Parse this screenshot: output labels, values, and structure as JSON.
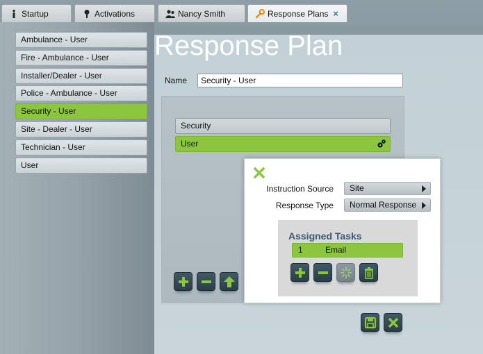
{
  "tabs": [
    {
      "label": "Startup",
      "icon": "info-icon"
    },
    {
      "label": "Activations",
      "icon": "pin-icon"
    },
    {
      "label": "Nancy Smith",
      "icon": "users-icon"
    },
    {
      "label": "Response Plans",
      "icon": "wrench-icon",
      "close": "×"
    }
  ],
  "plans": [
    "Ambulance - User",
    "Fire - Ambulance - User",
    "Installer/Dealer - User",
    "Police - Ambulance - User",
    "Security - User",
    "Site - Dealer - User",
    "Technician - User",
    "User"
  ],
  "selected_plan": "Security - User",
  "page": {
    "title": "Response Plan",
    "name_label": "Name",
    "name_value": "Security - User"
  },
  "groups": [
    "Security",
    "User"
  ],
  "popup": {
    "instruction_source_label": "Instruction Source",
    "instruction_source_value": "Site",
    "response_type_label": "Response Type",
    "response_type_value": "Normal Response",
    "assigned_tasks_title": "Assigned Tasks",
    "tasks": [
      {
        "number": "1",
        "name": "Email"
      }
    ]
  },
  "colors": {
    "accent_green": "#8cc63f",
    "button_dark": "#2f4652",
    "title_color": "#ffffff",
    "tasks_title": "#3a5a74",
    "tab_close": "#2c6f9a"
  }
}
